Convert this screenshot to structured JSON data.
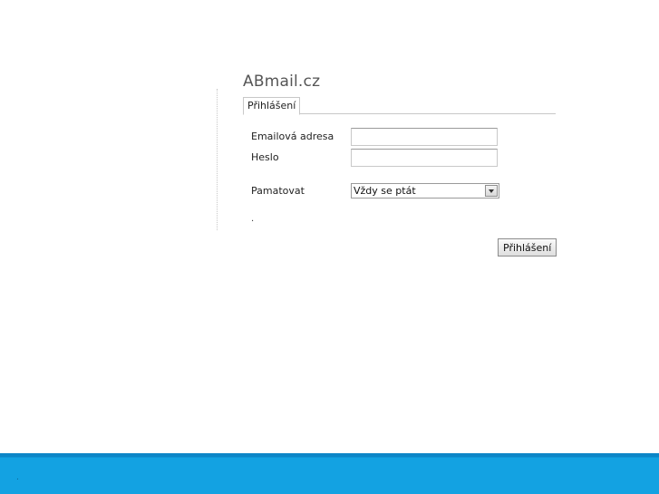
{
  "app": {
    "title": "ABmail.cz"
  },
  "tabs": [
    {
      "label": "Přihlášení",
      "active": true
    }
  ],
  "form": {
    "email_label": "Emailová adresa",
    "email_value": "",
    "password_label": "Heslo",
    "password_value": "",
    "remember_label": "Pamatovat",
    "remember_selected": "Vždy se ptát",
    "note_text": ".",
    "submit_label": "Přihlášení"
  },
  "footer": {
    "text": "."
  },
  "colors": {
    "footer_bg": "#13a2e2",
    "footer_top": "#0c86c7",
    "title_text": "#555555"
  }
}
